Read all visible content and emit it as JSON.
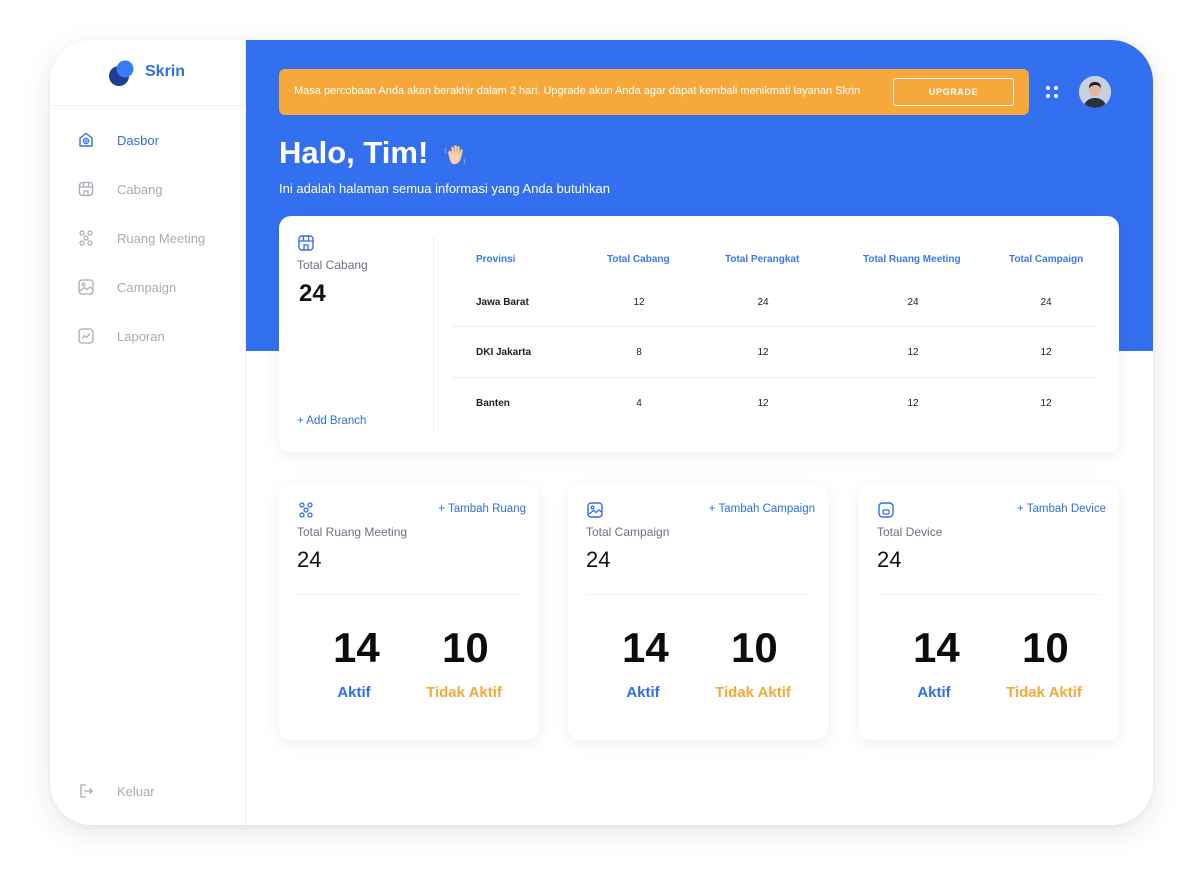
{
  "brand": {
    "name": "Skrin",
    "accent": "#2f6fe8"
  },
  "sidebar": {
    "items": [
      {
        "label": "Dasbor",
        "icon": "dashboard-icon",
        "active": true
      },
      {
        "label": "Cabang",
        "icon": "store-icon",
        "active": false
      },
      {
        "label": "Ruang Meeting",
        "icon": "people-icon",
        "active": false
      },
      {
        "label": "Campaign",
        "icon": "image-icon",
        "active": false
      },
      {
        "label": "Laporan",
        "icon": "chart-icon",
        "active": false
      }
    ],
    "logout": {
      "label": "Keluar",
      "icon": "logout-icon"
    }
  },
  "banner": {
    "text": "Masa percobaan Anda akan berakhir dalam 2 hari. Upgrade akun Anda agar dapat kembali menikmati layanan Skrin",
    "button": "UPGRADE",
    "color": "#f6a93a"
  },
  "header": {
    "greeting": "Halo, Tim!",
    "subtitle": "Ini adalah halaman semua informasi yang Anda butuhkan",
    "hero_color": "#3370f0"
  },
  "branch": {
    "label": "Total Cabang",
    "value": "24",
    "add_label": "+ Add Branch",
    "columns": [
      "Provinsi",
      "Total Cabang",
      "Total Perangkat",
      "Total Ruang Meeting",
      "Total Campaign"
    ],
    "rows": [
      [
        "Jawa Barat",
        "12",
        "24",
        "24",
        "24"
      ],
      [
        "DKI Jakarta",
        "8",
        "12",
        "12",
        "12"
      ],
      [
        "Banten",
        "4",
        "12",
        "12",
        "12"
      ]
    ]
  },
  "stats": [
    {
      "icon": "people-icon",
      "add_label": "+ Tambah Ruang",
      "label": "Total Ruang Meeting",
      "total": "24",
      "active": "14",
      "inactive": "10",
      "active_label": "Aktif",
      "inactive_label": "Tidak Aktif"
    },
    {
      "icon": "image-icon",
      "add_label": "+ Tambah Campaign",
      "label": "Total Campaign",
      "total": "24",
      "active": "14",
      "inactive": "10",
      "active_label": "Aktif",
      "inactive_label": "Tidak Aktif"
    },
    {
      "icon": "device-icon",
      "add_label": "+ Tambah Device",
      "label": "Total Device",
      "total": "24",
      "active": "14",
      "inactive": "10",
      "active_label": "Aktif",
      "inactive_label": "Tidak Aktif"
    }
  ]
}
